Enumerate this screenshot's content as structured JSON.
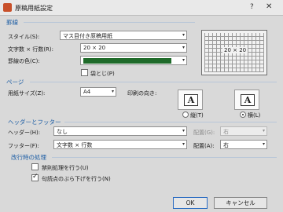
{
  "window": {
    "title": "原稿用紙設定",
    "help_symbol": "?",
    "close_symbol": "✕"
  },
  "grid_section": {
    "title": "罫線",
    "style_label": "スタイル(S):",
    "style_value": "マス目付き原稿用紙",
    "chars_lines_label": "文字数 × 行数(R):",
    "chars_lines_value": "20 × 20",
    "line_color_label": "罫線の色(C):",
    "line_color": "#1f6a2a",
    "fold_label": "袋とじ(P)",
    "fold_checked": false,
    "preview_label": "20 × 20"
  },
  "page_section": {
    "title": "ページ",
    "paper_size_label": "用紙サイズ(Z):",
    "paper_size_value": "A4",
    "orientation_label": "印刷の向き:",
    "portrait_label": "縦(T)",
    "landscape_label": "横(L)",
    "orientation_selected": "landscape"
  },
  "header_footer_section": {
    "title": "ヘッダーとフッター",
    "header_label": "ヘッダー(H):",
    "header_value": "なし",
    "header_align_label": "配置(G):",
    "header_align_value": "右",
    "footer_label": "フッター(F):",
    "footer_value": "文字数 × 行数",
    "footer_align_label": "配置(A):",
    "footer_align_value": "右"
  },
  "linebreak_section": {
    "title": "改行時の処理",
    "kinsoku_label": "禁則処理を行う(U)",
    "kinsoku_checked": false,
    "burasage_label": "句読点のぶら下げを行う(N)",
    "burasage_checked": true
  },
  "buttons": {
    "ok": "OK",
    "cancel": "キャンセル"
  },
  "icons": {
    "dropdown": "▾",
    "check": "✓",
    "app": "genkou-icon"
  }
}
